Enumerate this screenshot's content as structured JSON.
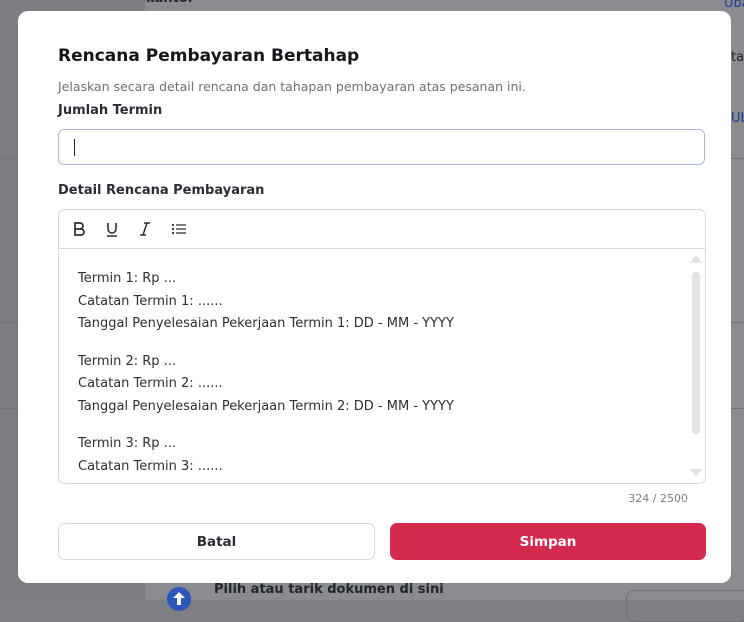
{
  "background": {
    "top_text": "kantor",
    "right_link_top": "Uba",
    "right_text_mid": "tar",
    "right_link_mid": "Uba",
    "bottom_text": "Pilih atau tarik dokumen di sini"
  },
  "modal": {
    "title": "Rencana Pembayaran Bertahap",
    "subtitle": "Jelaskan secara detail rencana dan tahapan pembayaran atas pesanan ini.",
    "terms_label": "Jumlah Termin",
    "terms_value": "",
    "detail_label": "Detail Rencana Pembayaran",
    "toolbar": {
      "bold_icon": "bold-icon",
      "underline_icon": "underline-icon",
      "italic_icon": "italic-icon",
      "list_icon": "bullet-list-icon"
    },
    "editor_lines": {
      "l1": "Termin 1: Rp ...",
      "l2": "Catatan Termin 1: ......",
      "l3": "Tanggal Penyelesaian Pekerjaan Termin 1: DD - MM - YYYY",
      "l4": "Termin 2: Rp ...",
      "l5": "Catatan Termin 2: ......",
      "l6": "Tanggal Penyelesaian Pekerjaan Termin 2: DD - MM - YYYY",
      "l7": "Termin 3: Rp ...",
      "l8": "Catatan Termin 3: ......"
    },
    "char_count": "324 / 2500",
    "cancel_label": "Batal",
    "save_label": "Simpan"
  },
  "colors": {
    "accent": "#d42a4e",
    "input_border_focus": "#a9b9de",
    "overlay": "#7b7d82"
  }
}
